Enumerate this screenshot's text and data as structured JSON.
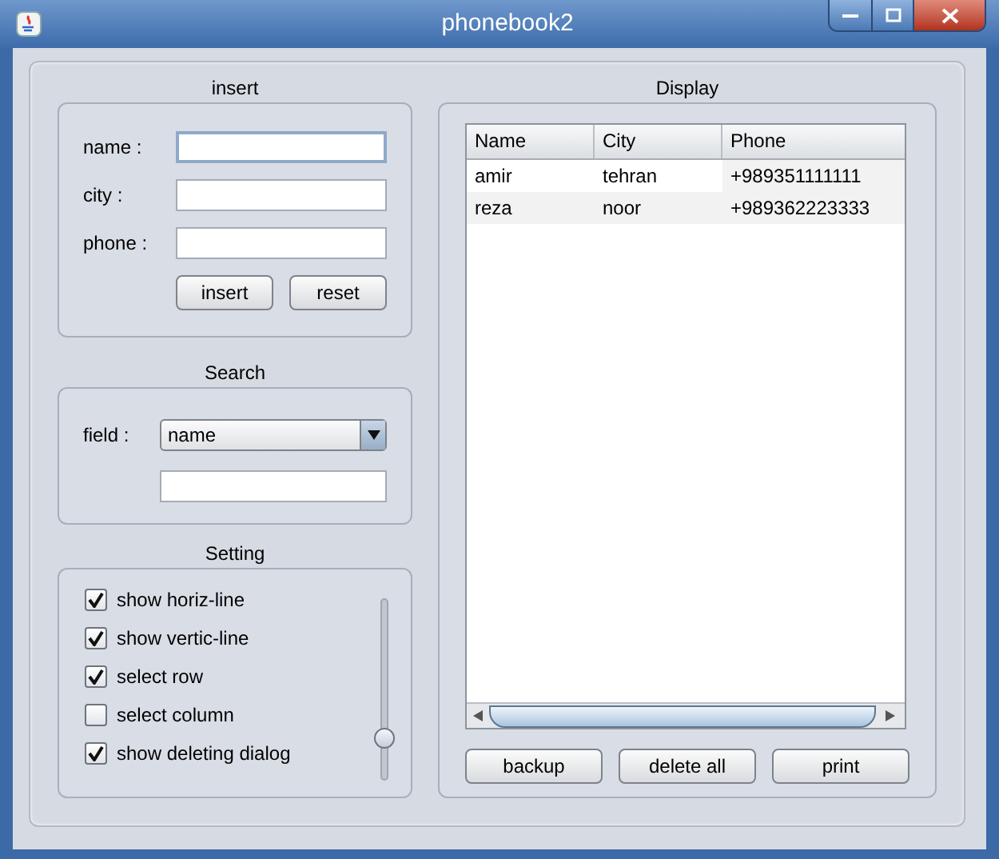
{
  "window": {
    "title": "phonebook2"
  },
  "insert": {
    "title": "insert",
    "fields": [
      {
        "label": "name :",
        "focused": true
      },
      {
        "label": "city :",
        "focused": false
      },
      {
        "label": "phone :",
        "focused": false
      }
    ],
    "buttons": [
      "insert",
      "reset"
    ]
  },
  "search": {
    "title": "Search",
    "label": "field :",
    "dropdown": {
      "value": "name"
    }
  },
  "setting": {
    "title": "Setting",
    "options": [
      {
        "label": "show horiz-line",
        "checked": true
      },
      {
        "label": "show vertic-line",
        "checked": true
      },
      {
        "label": "select row",
        "checked": true
      },
      {
        "label": "select column",
        "checked": false
      },
      {
        "label": "show deleting dialog",
        "checked": true
      }
    ],
    "slider": {
      "level": 0.25
    }
  },
  "display": {
    "title": "Display",
    "table": {
      "columns": [
        "Name",
        "City",
        "Phone"
      ],
      "rows": [
        [
          "amir",
          "tehran",
          "+989351111111"
        ],
        [
          "reza",
          "noor",
          "+989362223333"
        ]
      ]
    },
    "buttons": [
      "backup",
      "delete all",
      "print"
    ]
  }
}
